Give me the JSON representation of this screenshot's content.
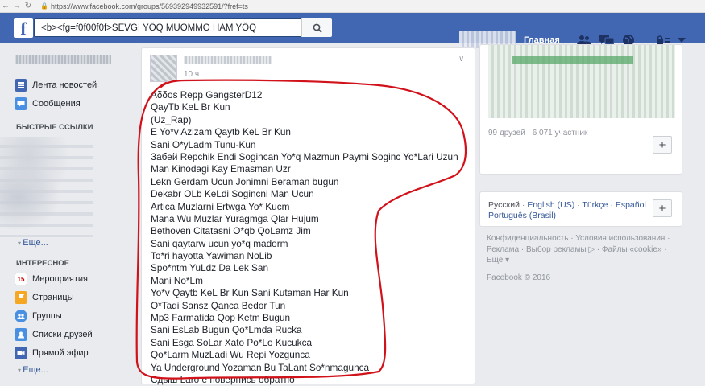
{
  "browser": {
    "url": "https://www.facebook.com/groups/569392949932591/?fref=ts",
    "back_icon": "arrow-left",
    "forward_icon": "arrow-right",
    "reload_icon": "reload"
  },
  "topbar": {
    "search_value": "<b><fg=f0f00f0f>SEVGI YÖQ MUOMMO HAM YÖQ",
    "home_label": "Главная",
    "icons": [
      "friends-icon",
      "messages-icon",
      "globe-icon",
      "privacy-lock-icon",
      "dropdown-icon"
    ]
  },
  "sidebar": {
    "nav": [
      {
        "label": "Лента новостей",
        "icon": "news-feed-icon"
      },
      {
        "label": "Сообщения",
        "icon": "messages-icon"
      }
    ],
    "quick_links_title": "БЫСТРЫЕ ССЫЛКИ",
    "quick_more": "Еще...",
    "interesting_title": "ИНТЕРЕСНОЕ",
    "interesting": [
      {
        "label": "Мероприятия",
        "icon": "calendar-icon",
        "badge": "15"
      },
      {
        "label": "Страницы",
        "icon": "flag-icon"
      },
      {
        "label": "Группы",
        "icon": "groups-icon"
      },
      {
        "label": "Списки друзей",
        "icon": "friend-lists-icon"
      },
      {
        "label": "Прямой эфир",
        "icon": "live-video-icon"
      }
    ],
    "interesting_more": "Еще..."
  },
  "post": {
    "time": "10 ч",
    "lines": [
      "Aδδos Reҏҏ GangsterD12",
      "QayTb KeL Br Kun",
      "(Uz_Rap)",
      "E Yo*v Azizam Qaytb KeL Br Kun",
      "Sani O*yLadm Tunu-Kun",
      "Забей Repchik Endi Sogincan Yo*q Mazmun Paymi Soginc Yo*Lari Uzun",
      "Man Kinodagi Kay Emasman Uzr",
      "Lekn Gerdam Ucun Jonimni Beraman bugun",
      "Dekabr OLb KeLdi Sogincni Man Ucun",
      "Artica Muzlarni Ertwga Yo* Kucm",
      "Mana Wu Muzlar Yuragmga Qlar Hujum",
      "Bethoven Citatasni O*qb QoLamz Jim",
      "Sani qaytarw ucun yo*q madorm",
      "To*ri hayotta Yawiman NoLib",
      "Spo*ntm YuLdz Da Lek San",
      "Mani No*Lm",
      "Yo*v Qaytb KeL Br Kun Sani Kutaman Har Kun",
      "O*Tadi Sansz Qanca Bedor Tun",
      "Mp3 Farmatida Qop Ketm Bugun",
      "Sani EsLab Bugun Qo*Lmda Rucka",
      "Sani Esga SoLar Xato Po*Lo Kucukca",
      "Qo*Larm MuzLadi Wu Repi Yozgunca",
      "Ya Underground Yozaman Bu TaLant So*nmagunca"
    ],
    "cut_line": "Сдыш Laro е повернись обратно"
  },
  "right": {
    "group_stats": "99 друзей · 6 071 участник",
    "languages": {
      "current": "Русский",
      "others": [
        "English (US)",
        "Türkçe",
        "Español",
        "Português (Brasil)"
      ]
    },
    "footer": {
      "line1": "Конфиденциальность · Условия использования ·",
      "line2": "Реклама · Выбор рекламы ▷ · Файлы «cookie» ·",
      "line3": "Еще ▾",
      "copyright": "Facebook © 2016"
    }
  },
  "colors": {
    "brand": "#4267b2",
    "link": "#365899",
    "annotation": "#d1121a"
  }
}
